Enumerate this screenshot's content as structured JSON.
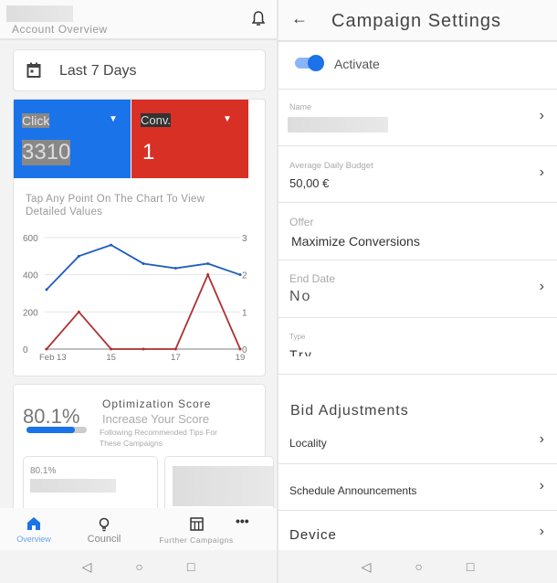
{
  "left": {
    "header": {
      "subtitle": "Account Overview",
      "icon": "bell-icon"
    },
    "date_range": {
      "icon": "calendar-icon",
      "label": "Last 7 Days"
    },
    "metrics": [
      {
        "label": "Click",
        "value": "3310",
        "color": "#1a73e8"
      },
      {
        "label": "Conv.",
        "value": "1",
        "color": "#d93025"
      }
    ],
    "chart_hint": "Tap Any Point On The Chart To View Detailed Values",
    "chart_data": {
      "type": "line",
      "x": [
        "Feb 13",
        "Feb 14",
        "Feb 15",
        "Feb 16",
        "Feb 17",
        "Feb 18",
        "Feb 19"
      ],
      "x_tick_labels": [
        "Feb 13",
        "15",
        "17",
        "19"
      ],
      "left_ticks": [
        "0",
        "200",
        "400",
        "600"
      ],
      "right_ticks": [
        "0",
        "1",
        "2",
        "3"
      ],
      "ylim_left": [
        0,
        600
      ],
      "ylim_right": [
        0,
        3
      ],
      "grid": true,
      "series": [
        {
          "axis": "left",
          "color": "#1f5fbf",
          "values": [
            320,
            500,
            560,
            460,
            435,
            460,
            400
          ]
        },
        {
          "axis": "right",
          "color": "#b03030",
          "values": [
            0,
            1,
            0,
            0,
            0,
            2,
            0
          ]
        }
      ]
    },
    "optimization": {
      "score": "80.1%",
      "score_fraction": 0.801,
      "title": "Optimization Score",
      "subtitle": "Increase Your Score",
      "desc": "Following Recommended Tips For These Campaigns",
      "mini_score": "80.1%"
    },
    "bottom_nav": [
      {
        "label": "Overview",
        "icon": "home-icon",
        "active": true
      },
      {
        "label": "Council",
        "icon": "lightbulb-icon"
      },
      {
        "label": "Further Campaigns",
        "icon": "table-icon"
      },
      {
        "label": "",
        "icon": "more-icon"
      }
    ]
  },
  "right": {
    "header": {
      "title": "Campaign Settings",
      "icon": "back-arrow-icon"
    },
    "toggle": {
      "label": "Activate",
      "on": true
    },
    "fields": [
      {
        "label": "Name",
        "value": ""
      },
      {
        "label": "Average Daily Budget",
        "value": "50,00 €"
      },
      {
        "label": "Offer",
        "value": "Maximize Conversions"
      },
      {
        "label": "End Date",
        "value": "No"
      },
      {
        "label": "Type",
        "value": "Try"
      }
    ],
    "section_title": "Bid Adjustments",
    "adjustments": [
      "Locality",
      "Schedule Announcements",
      "Device"
    ]
  },
  "system_nav": [
    "back-icon",
    "home-circle-icon",
    "recents-icon"
  ]
}
